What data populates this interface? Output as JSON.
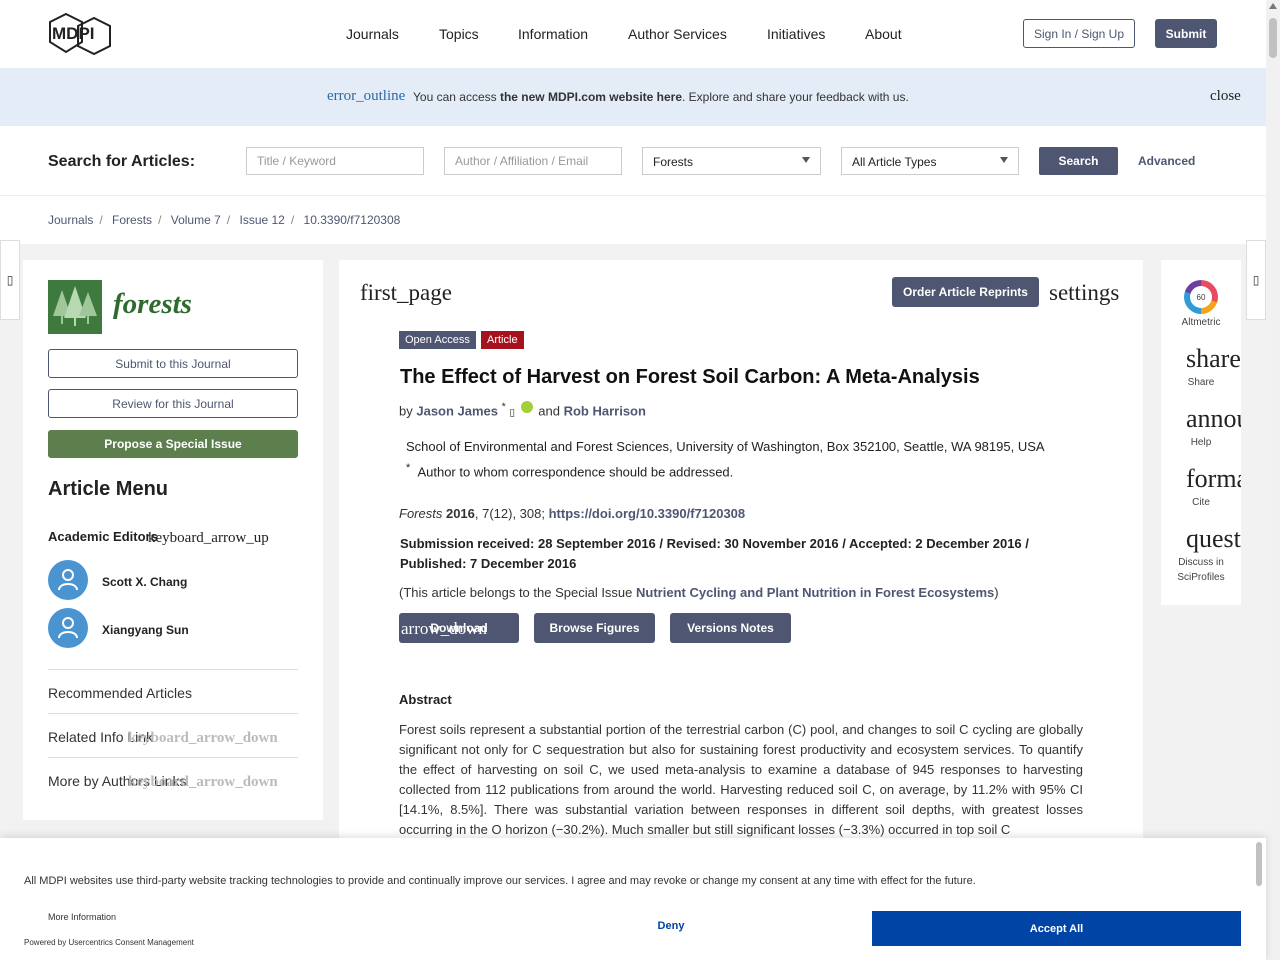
{
  "header": {
    "logo_text": "MDPI",
    "nav": [
      "Journals",
      "Topics",
      "Information",
      "Author Services",
      "Initiatives",
      "About"
    ],
    "sign_in_label": "Sign In / Sign Up",
    "submit_label": "Submit"
  },
  "banner": {
    "icon": "error_outline",
    "text_prefix": "You can access ",
    "text_link": "the new MDPI.com website here",
    "text_suffix": ". Explore and share your feedback with us.",
    "close": "close"
  },
  "search": {
    "label": "Search for Articles:",
    "keyword_placeholder": "Title / Keyword",
    "author_placeholder": "Author / Affiliation / Email",
    "journal_value": "Forests",
    "type_value": "All Article Types",
    "search_button": "Search",
    "advanced": "Advanced"
  },
  "breadcrumb": [
    "Journals",
    "Forests",
    "Volume 7",
    "Issue 12",
    "10.3390/f7120308"
  ],
  "left": {
    "journal_name": "forests",
    "submit_btn": "Submit to this Journal",
    "review_btn": "Review for this Journal",
    "propose_btn": "Propose a Special Issue",
    "article_menu": "Article Menu",
    "academic_editors": "Academic Editors",
    "editors_toggle": "keyboard_arrow_up",
    "editors": [
      "Scott X. Chang",
      "Xiangyang Sun"
    ],
    "recommended": "Recommended Articles",
    "related_info": "Related Info Link",
    "related_toggle": "keyboard_arrow_down",
    "more_by": "More by Authors Links",
    "more_toggle": "keyboard_arrow_down"
  },
  "article": {
    "first_page": "first_page",
    "order_reprints": "Order Article Reprints",
    "settings": "settings",
    "badge_open_access": "Open Access",
    "badge_article": "Article",
    "title": "The Effect of Harvest on Forest Soil Carbon: A Meta-Analysis",
    "by": "by",
    "author1": "Jason James",
    "author1_mark": "*",
    "and": "and",
    "author2": "Rob Harrison",
    "affiliation": "School of Environmental and Forest Sciences, University of Washington, Box 352100, Seattle, WA 98195, USA",
    "corr_mark": "*",
    "correspondence": "Author to whom correspondence should be addressed.",
    "cite_journal": "Forests",
    "cite_year": "2016",
    "cite_rest": ", 7(12), 308; ",
    "doi": "https://doi.org/10.3390/f7120308",
    "dates": "Submission received: 28 September 2016 / Revised: 30 November 2016 / Accepted: 2 December 2016 / Published: 7 December 2016",
    "special_prefix": "(This article belongs to the Special Issue ",
    "special_link": "Nutrient Cycling and Plant Nutrition in Forest Ecosystems",
    "special_suffix": ")",
    "download": "Download",
    "download_icon": "arrow_down",
    "browse_figures": "Browse Figures",
    "versions_notes": "Versions Notes",
    "abstract_heading": "Abstract",
    "abstract_text": "Forest soils represent a substantial portion of the terrestrial carbon (C) pool, and changes to soil C cycling are globally significant not only for C sequestration but also for sustaining forest productivity and ecosystem services. To quantify the effect of harvesting on soil C, we used meta-analysis to examine a database of 945 responses to harvesting collected from 112 publications from around the world. Harvesting reduced soil C, on average, by 11.2% with 95% CI [14.1%, 8.5%]. There was substantial variation between responses in different soil depths, with greatest losses occurring in the O horizon (−30.2%). Much smaller but still significant losses (−3.3%) occurred in top soil C"
  },
  "right": {
    "altmetric_score": "60",
    "altmetric_label": "Altmetric",
    "share_icon": "share",
    "share_label": "Share",
    "help_icon": "announcement",
    "help_label": "Help",
    "cite_icon": "format_quote",
    "cite_label": "Cite",
    "discuss_icon": "question_answer",
    "discuss_label_1": "Discuss in",
    "discuss_label_2": "SciProfiles"
  },
  "consent": {
    "text": "All MDPI websites use third-party website tracking technologies to provide and continually improve our services. I agree and may revoke or change my consent at any time with effect for the future.",
    "more_info": "More Information",
    "powered": "Powered by Usercentrics Consent Management",
    "deny": "Deny",
    "accept": "Accept All"
  },
  "colors": {
    "brand": "#4f5671",
    "banner_bg": "#e3ecf7",
    "article_badge": "#a5121e",
    "forests_green": "#5d7f4e",
    "consent_blue": "#0045a5"
  }
}
